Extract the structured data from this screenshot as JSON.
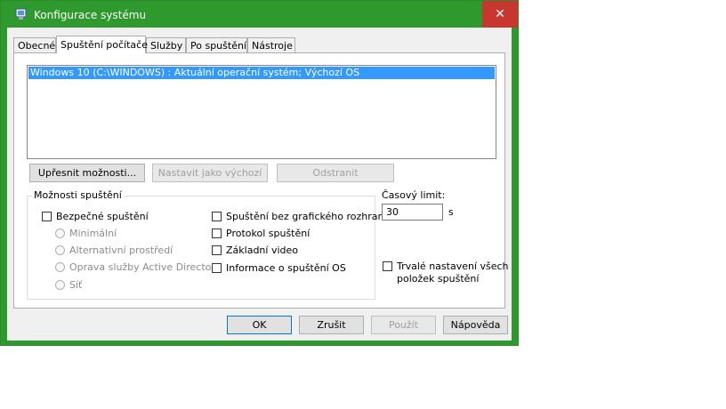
{
  "window": {
    "title": "Konfigurace systému",
    "close_glyph": "✕"
  },
  "tabs": [
    {
      "label": "Obecné"
    },
    {
      "label": "Spuštění počítače"
    },
    {
      "label": "Služby"
    },
    {
      "label": "Po spuštění"
    },
    {
      "label": "Nástroje"
    }
  ],
  "boot_list": {
    "items": [
      "Windows 10 (C:\\WINDOWS) : Aktuální operační systém; Výchozí OS"
    ]
  },
  "boot_buttons": {
    "advanced": "Upřesnit možnosti...",
    "set_default": "Nastavit jako výchozí",
    "delete": "Odstranit"
  },
  "boot_options": {
    "group_title": "Možnosti spuštění",
    "safe_boot": "Bezpečné spuštění",
    "minimal": "Minimální",
    "alternate_shell": "Alternativní prostředí",
    "ad_repair": "Oprava služby Active Directory",
    "network": "Síť",
    "no_gui": "Spuštění bez grafického rozhraní",
    "boot_log": "Protokol spuštění",
    "base_video": "Základní video",
    "os_boot_info": "Informace o spuštění OS"
  },
  "timeout": {
    "label": "Časový limit:",
    "value": "30",
    "unit": "s"
  },
  "permanent": {
    "line1": "Trvalé nastavení všech",
    "line2": "položek spuštění"
  },
  "footer": {
    "ok": "OK",
    "cancel": "Zrušit",
    "apply": "Použít",
    "help": "Nápověda"
  },
  "colors": {
    "titlebar": "#2e9a2e",
    "close": "#c7372f",
    "selection": "#3399ff"
  }
}
